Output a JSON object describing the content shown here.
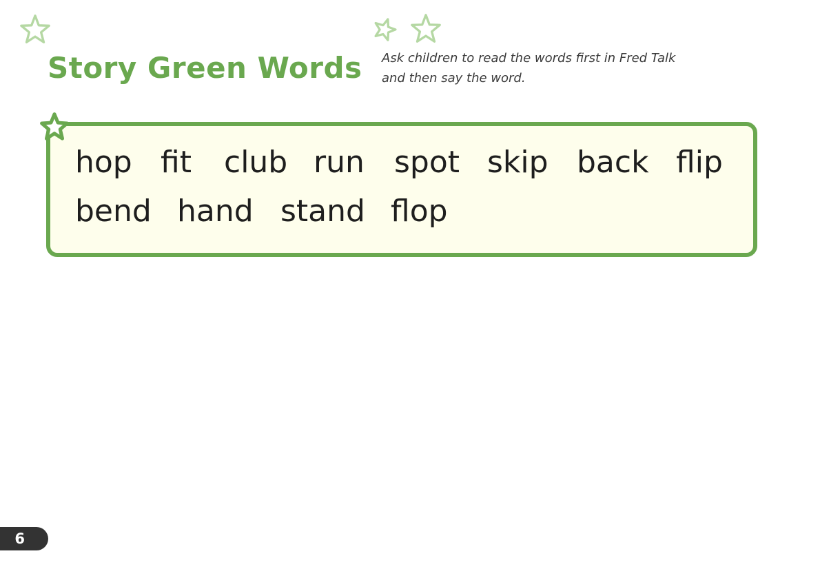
{
  "title": "Story Green Words",
  "instructions": {
    "line1": "Ask children to read the words first in Fred Talk",
    "line2": "and then say the word."
  },
  "words_row1": [
    "hop",
    "fit",
    "club",
    "run",
    "spot",
    "skip",
    "back",
    "flip"
  ],
  "words_row2": [
    "bend",
    "hand",
    "stand",
    "flop"
  ],
  "page_number": "6",
  "colors": {
    "accent_green": "#6aa84f",
    "light_star_green": "#b5d8a3",
    "box_fill": "#fefeec",
    "page_tab": "#333333"
  },
  "icons": [
    "star-outline-icon",
    "star-icon"
  ]
}
